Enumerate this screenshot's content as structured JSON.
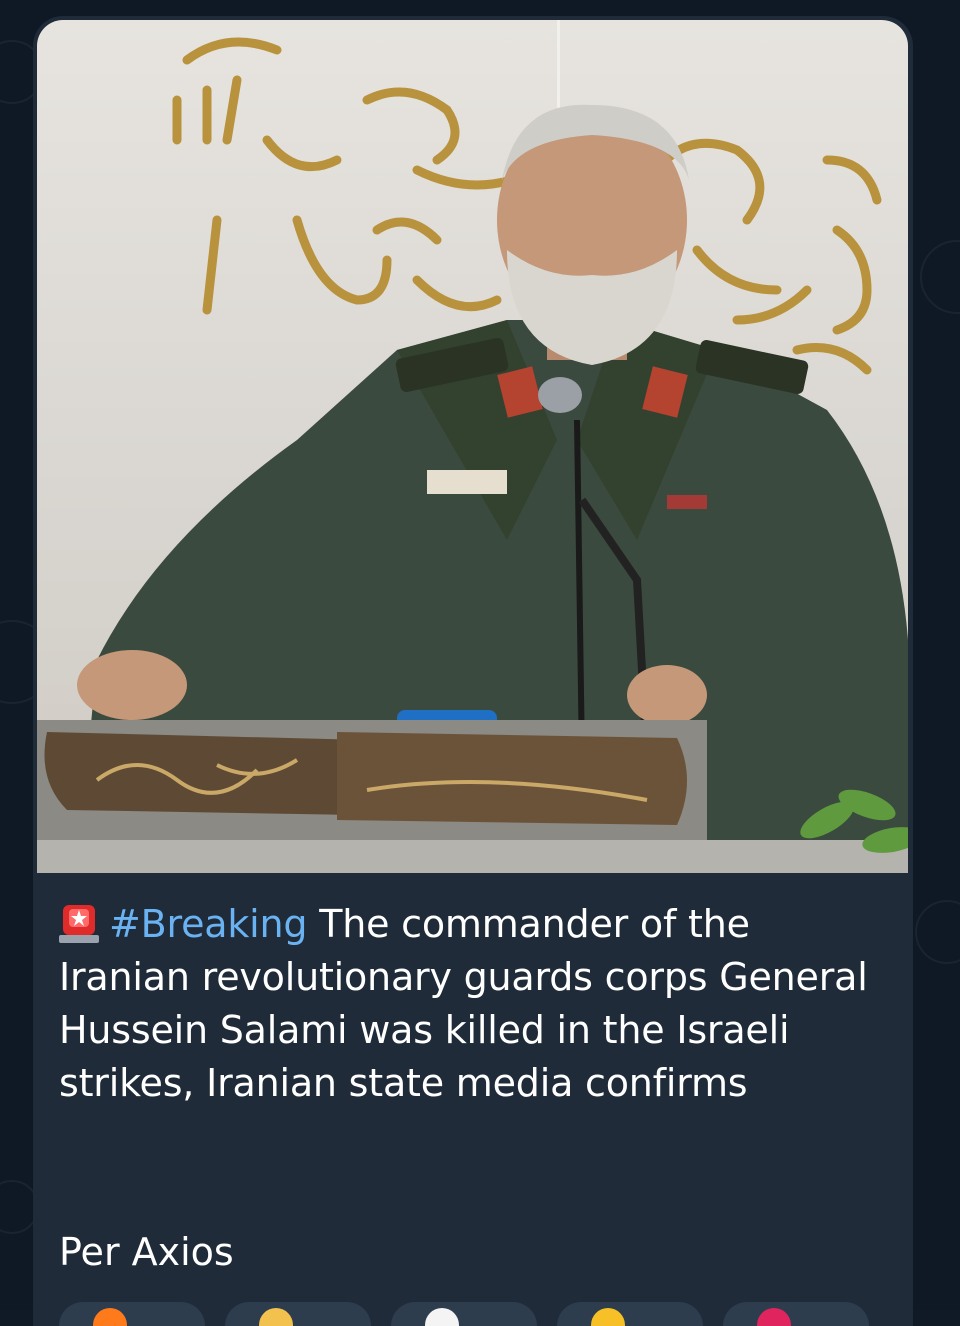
{
  "post": {
    "photo_alt": "Commander speaking at podium",
    "siren_icon": "police-car-light-emoji",
    "hashtag": "#Breaking",
    "text": " The commander of the Iranian revolutionary guards corps General Hussein Salami was killed in the Israeli strikes, Iranian state media confirms",
    "source": "Per Axios"
  },
  "reactions": [
    {
      "icon": "fire-emoji",
      "color": "#ff7a1a"
    },
    {
      "icon": "thumbs-up-emoji",
      "color": "#f2c14e"
    },
    {
      "icon": "eyes-emoji",
      "color": "#f4f4f4"
    },
    {
      "icon": "face-emoji",
      "color": "#f6c026"
    },
    {
      "icon": "heart-emoji",
      "color": "#e0245e"
    }
  ],
  "colors": {
    "bubble": "#1f2b38",
    "hashtag": "#6ab2f2",
    "text": "#ffffff"
  }
}
